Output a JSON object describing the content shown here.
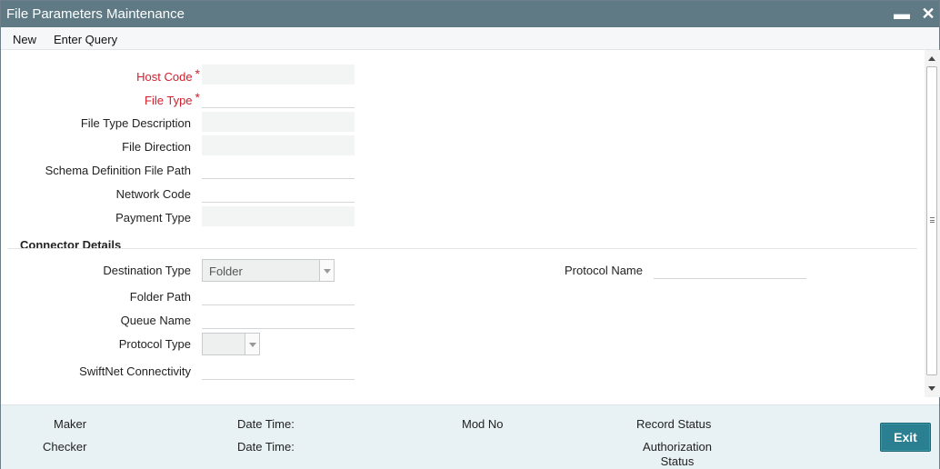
{
  "window": {
    "title": "File Parameters Maintenance",
    "minimize_glyph": "▬",
    "close_glyph": "✕"
  },
  "menu": {
    "new": "New",
    "enter_query": "Enter Query"
  },
  "form": {
    "host_code": {
      "label": "Host Code",
      "required_mark": "*",
      "value": ""
    },
    "file_type": {
      "label": "File Type",
      "required_mark": "*",
      "value": ""
    },
    "file_type_description": {
      "label": "File Type Description",
      "value": ""
    },
    "file_direction": {
      "label": "File Direction",
      "value": ""
    },
    "schema_definition_file_path": {
      "label": "Schema Definition File Path",
      "value": ""
    },
    "network_code": {
      "label": "Network Code",
      "value": ""
    },
    "payment_type": {
      "label": "Payment Type",
      "value": ""
    }
  },
  "connector": {
    "section_title": "Connector Details",
    "destination_type": {
      "label": "Destination Type",
      "selected": "Folder"
    },
    "folder_path": {
      "label": "Folder Path",
      "value": ""
    },
    "queue_name": {
      "label": "Queue Name",
      "value": ""
    },
    "protocol_type": {
      "label": "Protocol Type",
      "selected": ""
    },
    "swiftnet_connectivity": {
      "label": "SwiftNet Connectivity",
      "value": ""
    },
    "protocol_name": {
      "label": "Protocol Name",
      "value": ""
    }
  },
  "footer": {
    "maker": "Maker",
    "checker": "Checker",
    "date_time_1": "Date Time:",
    "date_time_2": "Date Time:",
    "mod_no": "Mod No",
    "record_status": "Record Status",
    "authorization_status": "Authorization Status",
    "exit": "Exit"
  },
  "colors": {
    "titlebar": "#5f7a85",
    "required": "#d0202e",
    "footer_bg": "#e8f1f3",
    "exit_button": "#2a7f90"
  }
}
